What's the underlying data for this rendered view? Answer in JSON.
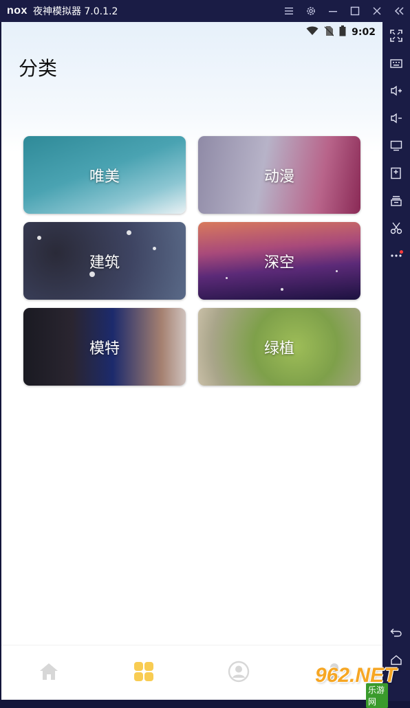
{
  "window": {
    "logo_text": "nox",
    "title": "夜神模拟器 7.0.1.2"
  },
  "titlebar_icons": [
    "menu-icon",
    "gear-icon",
    "minimize-icon",
    "maximize-icon",
    "close-icon",
    "collapse-icon"
  ],
  "sidebar_icons": [
    "fullscreen-icon",
    "keyboard-icon",
    "volume-up-icon",
    "volume-down-icon",
    "screen-icon",
    "install-apk-icon",
    "multi-instance-icon",
    "scissors-icon",
    "more-icon",
    "back-icon",
    "home-icon"
  ],
  "statusbar": {
    "time": "9:02"
  },
  "page": {
    "title": "分类"
  },
  "categories": [
    {
      "label": "唯美"
    },
    {
      "label": "动漫"
    },
    {
      "label": "建筑"
    },
    {
      "label": "深空"
    },
    {
      "label": "模特"
    },
    {
      "label": "绿植"
    }
  ],
  "bottom_nav": [
    {
      "name": "home",
      "icon": "home-icon",
      "active": false
    },
    {
      "name": "category",
      "icon": "grid-icon",
      "active": true
    },
    {
      "name": "profile",
      "icon": "user-icon",
      "active": false
    },
    {
      "name": "more",
      "icon": "user-icon",
      "active": false
    }
  ],
  "colors": {
    "nav_active": "#f8cc52",
    "nav_inactive": "#d7d7d7",
    "emulator_chrome": "#1a1c45"
  },
  "watermark": {
    "main": "962.NET",
    "sub": "乐游网"
  }
}
